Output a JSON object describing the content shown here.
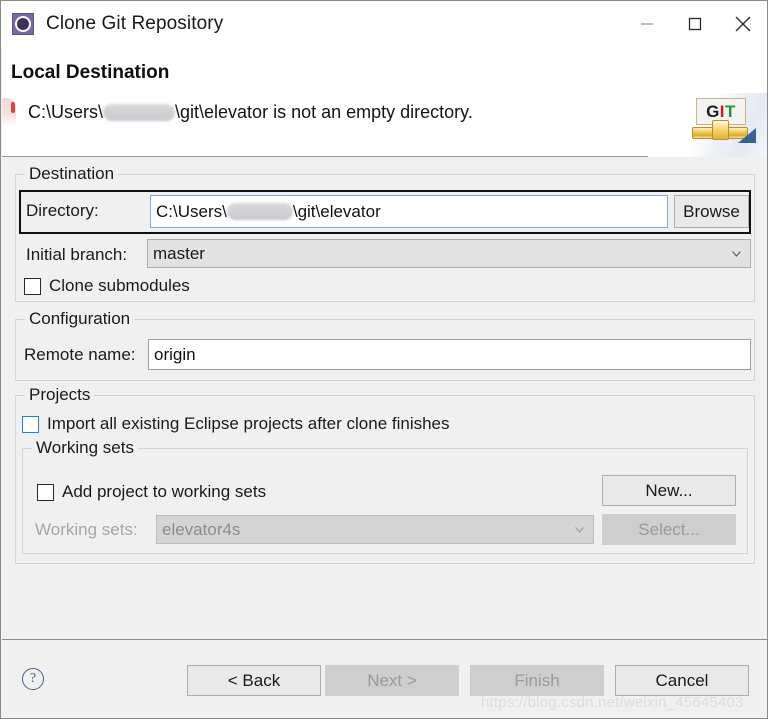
{
  "window": {
    "title": "Clone Git Repository",
    "icon": "eclipse-git-wizard-icon",
    "controls": {
      "minimize": "—",
      "maximize": "□",
      "close": "✕"
    }
  },
  "header": {
    "title": "Local Destination",
    "message_prefix": "C:\\Users\\",
    "message_suffix": "\\git\\elevator is not an empty directory.",
    "status_icon": "error-icon",
    "brand": {
      "plate_g": "G",
      "plate_i": "I",
      "plate_t": "T"
    }
  },
  "destination": {
    "legend": "Destination",
    "directory_label": "Directory:",
    "directory_value_prefix": "C:\\Users\\",
    "directory_value_suffix": "\\git\\elevator",
    "browse_label": "Browse",
    "initial_branch_label": "Initial branch:",
    "initial_branch_value": "master",
    "clone_submodules_label": "Clone submodules",
    "clone_submodules_checked": false
  },
  "configuration": {
    "legend": "Configuration",
    "remote_name_label": "Remote name:",
    "remote_name_value": "origin"
  },
  "projects": {
    "legend": "Projects",
    "import_label": "Import all existing Eclipse projects after clone finishes",
    "import_checked": false,
    "working_sets": {
      "legend": "Working sets",
      "add_label": "Add project to working sets",
      "add_checked": false,
      "new_label": "New...",
      "sets_label": "Working sets:",
      "sets_value": "elevator4s",
      "select_label": "Select..."
    }
  },
  "footer": {
    "help": "?",
    "back_label": "< Back",
    "next_label": "Next >",
    "finish_label": "Finish",
    "cancel_label": "Cancel",
    "watermark": "https://blog.csdn.net/weixin_45645403"
  },
  "colors": {
    "dialog_bg": "#f0f0f0",
    "header_bg": "#ffffff",
    "field_border_focus": "#7aabda",
    "accent_blue": "#2a7fc2",
    "error_red": "#d94545",
    "disabled_text": "#9a9a9a"
  }
}
